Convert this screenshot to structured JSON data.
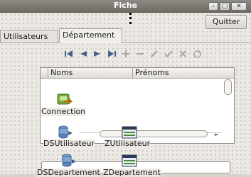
{
  "window": {
    "title": "Fiche"
  },
  "toolbar": {
    "quit_label": "Quitter"
  },
  "tabs": [
    {
      "label": "Utilisateurs",
      "active": false
    },
    {
      "label": "Département",
      "active": true
    }
  ],
  "navigator": {
    "buttons": [
      "first-icon",
      "prior-icon",
      "next-icon",
      "last-icon",
      "insert-icon",
      "delete-icon",
      "edit-icon",
      "post-icon",
      "cancel-icon",
      "refresh-icon"
    ],
    "active_color": "#4a5f8c",
    "disabled_color": "#a9a7a3"
  },
  "grid": {
    "columns": [
      "Noms",
      "Prénoms"
    ]
  },
  "components": {
    "connection": {
      "label": "Connection",
      "icon": "database-connection-icon"
    },
    "ds_utilisateur": {
      "label": "DSUtilisateur",
      "icon": "datasource-icon"
    },
    "z_utilisateur": {
      "label": "ZUtilisateur",
      "icon": "query-table-icon"
    },
    "ds_departement": {
      "label": "DSDepartement",
      "icon": "datasource-icon"
    },
    "z_departement": {
      "label": "ZDepartement",
      "icon": "query-table-icon"
    }
  }
}
